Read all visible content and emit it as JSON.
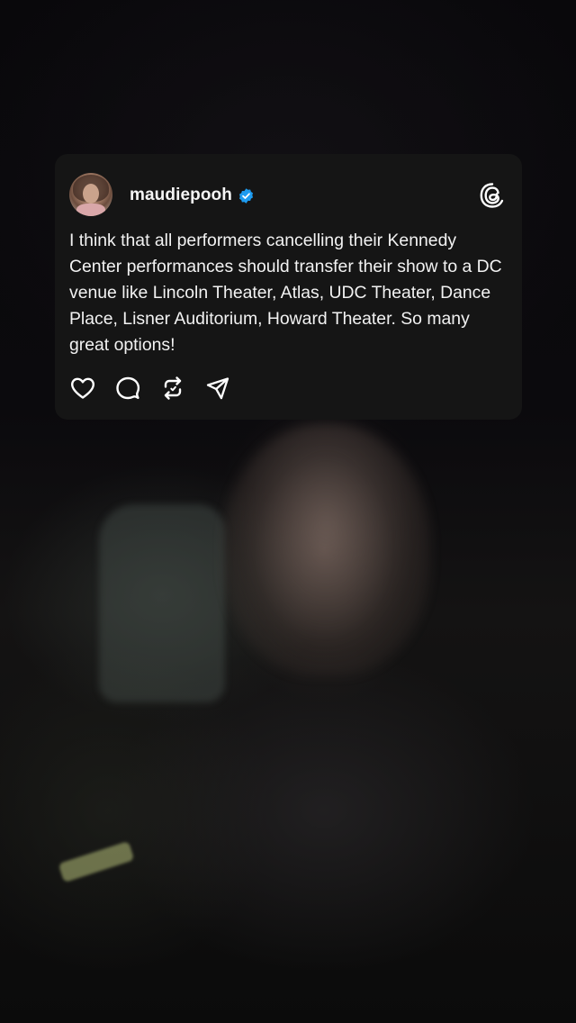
{
  "post": {
    "username": "maudiepooh",
    "verified": true,
    "text": "I think that all performers cancelling their Kennedy Center performances should transfer their show to a DC venue like Lincoln Theater, Atlas, UDC Theater, Dance Place, Lisner Auditorium, Howard Theater. So many great options!",
    "actions": [
      "like-icon",
      "comment-icon",
      "repost-icon",
      "share-icon"
    ]
  },
  "icons": {
    "verified": "verified-badge-icon",
    "platform": "threads-logo-icon"
  },
  "colors": {
    "card_background": "#151515",
    "text": "#f2f2f2",
    "verified_blue": "#1d9bf0",
    "screen_background": "#070707"
  }
}
